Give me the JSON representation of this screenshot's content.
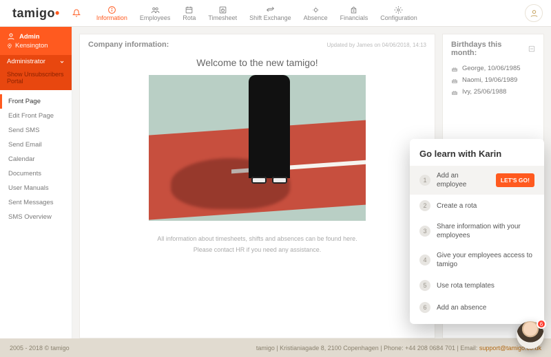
{
  "brand": "tamigo",
  "nav": [
    {
      "key": "information",
      "label": "Information",
      "active": true
    },
    {
      "key": "employees",
      "label": "Employees"
    },
    {
      "key": "rota",
      "label": "Rota"
    },
    {
      "key": "timesheet",
      "label": "Timesheet"
    },
    {
      "key": "shift-exchange",
      "label": "Shift Exchange"
    },
    {
      "key": "absence",
      "label": "Absence"
    },
    {
      "key": "financials",
      "label": "Financials"
    },
    {
      "key": "configuration",
      "label": "Configuration"
    }
  ],
  "sidebar": {
    "user_name": "Admin",
    "location": "Kensington",
    "role": "Administrator",
    "unsub": "Show Unsubscribers Portal",
    "items": [
      {
        "label": "Front Page",
        "active": true
      },
      {
        "label": "Edit Front Page"
      },
      {
        "label": "Send SMS"
      },
      {
        "label": "Send Email"
      },
      {
        "label": "Calendar"
      },
      {
        "label": "Documents"
      },
      {
        "label": "User Manuals"
      },
      {
        "label": "Sent Messages"
      },
      {
        "label": "SMS Overview"
      }
    ]
  },
  "company_info": {
    "title": "Company information:",
    "updated_by": "Updated by James on 04/06/2018, 14:13",
    "welcome": "Welcome to the new tamigo!",
    "line1": "All information about timesheets, shifts and absences can be found here.",
    "line2": "Please contact HR if you need any assistance."
  },
  "birthdays": {
    "title": "Birthdays this month:",
    "items": [
      {
        "name": "George",
        "date": "10/06/1985"
      },
      {
        "name": "Naomi",
        "date": "19/06/1989"
      },
      {
        "name": "Ivy",
        "date": "25/06/1988"
      }
    ]
  },
  "learn": {
    "title": "Go learn with Karin",
    "cta": "LET'S GO!",
    "steps": [
      "Add an employee",
      "Create a rota",
      "Share information with your employees",
      "Give your employees access to tamigo",
      "Use rota templates",
      "Add an absence"
    ],
    "badge_count": "6"
  },
  "footer": {
    "left": "2005 - 2018 © tamigo",
    "right_prefix": "tamigo | Kristianiagade 8, 2100 Copenhagen | Phone: +44 208 0684 701 | Email: ",
    "email": "support@tamigo.co.uk"
  }
}
